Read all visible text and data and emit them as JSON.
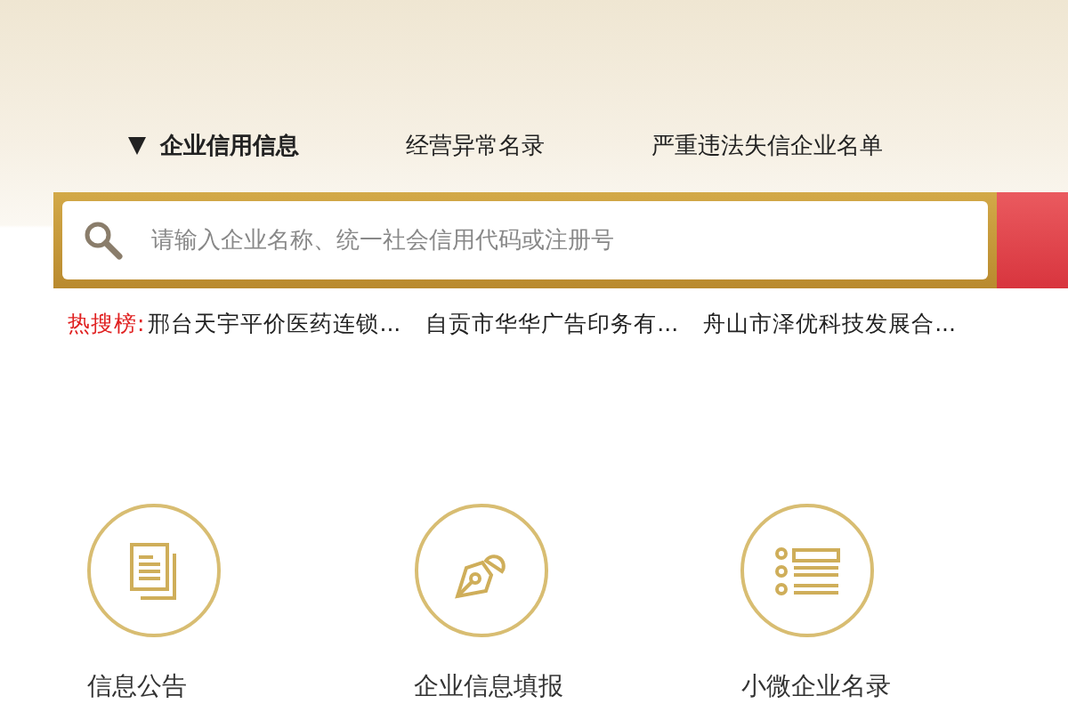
{
  "tabs": [
    {
      "label": "企业信用信息",
      "selected": true
    },
    {
      "label": "经营异常名录",
      "selected": false
    },
    {
      "label": "严重违法失信企业名单",
      "selected": false
    }
  ],
  "search": {
    "placeholder": "请输入企业名称、统一社会信用代码或注册号"
  },
  "hot_search": {
    "label": "热搜榜:",
    "items": [
      "邢台天宇平价医药连锁...",
      "自贡市华华广告印务有...",
      "舟山市泽优科技发展合..."
    ]
  },
  "services": [
    {
      "kind": "document",
      "label": "信息公告"
    },
    {
      "kind": "pen",
      "label": "企业信息填报"
    },
    {
      "kind": "list",
      "label": "小微企业名录"
    }
  ]
}
